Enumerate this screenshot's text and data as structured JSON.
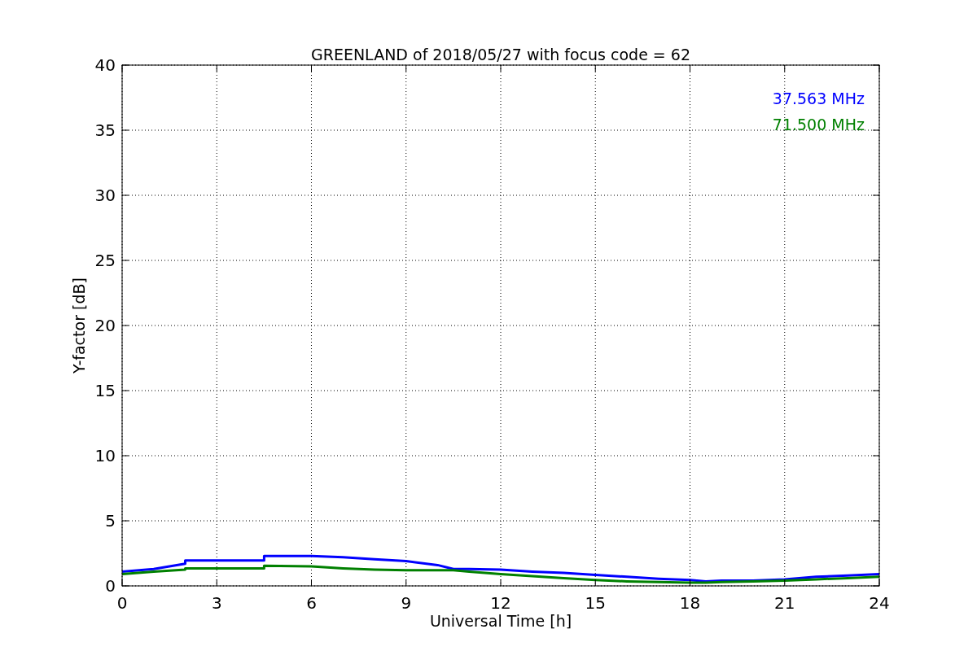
{
  "chart_data": {
    "type": "line",
    "title": "GREENLAND of 2018/05/27 with focus code = 62",
    "xlabel": "Universal Time [h]",
    "ylabel": "Y-factor [dB]",
    "x": [
      0,
      1,
      2,
      2,
      3,
      4.5,
      4.5,
      6,
      7,
      8,
      9,
      10,
      10.5,
      11,
      12,
      13,
      14,
      15,
      16,
      17,
      18,
      18.5,
      19,
      20,
      21,
      22,
      23,
      24
    ],
    "series": [
      {
        "name": "37.563 MHz",
        "color": "#0000ff",
        "values": [
          1.1,
          1.3,
          1.7,
          1.95,
          1.95,
          1.95,
          2.3,
          2.3,
          2.2,
          2.05,
          1.9,
          1.6,
          1.3,
          1.3,
          1.25,
          1.1,
          1.0,
          0.85,
          0.7,
          0.55,
          0.45,
          0.35,
          0.4,
          0.4,
          0.5,
          0.7,
          0.8,
          0.9
        ]
      },
      {
        "name": "71.500 MHz",
        "color": "#008000",
        "values": [
          0.9,
          1.1,
          1.25,
          1.35,
          1.35,
          1.35,
          1.55,
          1.5,
          1.35,
          1.25,
          1.2,
          1.2,
          1.2,
          1.1,
          0.9,
          0.75,
          0.6,
          0.45,
          0.35,
          0.3,
          0.25,
          0.25,
          0.3,
          0.35,
          0.4,
          0.5,
          0.6,
          0.7
        ]
      }
    ],
    "grid": true,
    "xlim": [
      0,
      24
    ],
    "ylim": [
      0,
      40
    ],
    "xticks": [
      0,
      3,
      6,
      9,
      12,
      15,
      18,
      21,
      24
    ],
    "yticks": [
      0,
      5,
      10,
      15,
      20,
      25,
      30,
      35,
      40
    ]
  }
}
